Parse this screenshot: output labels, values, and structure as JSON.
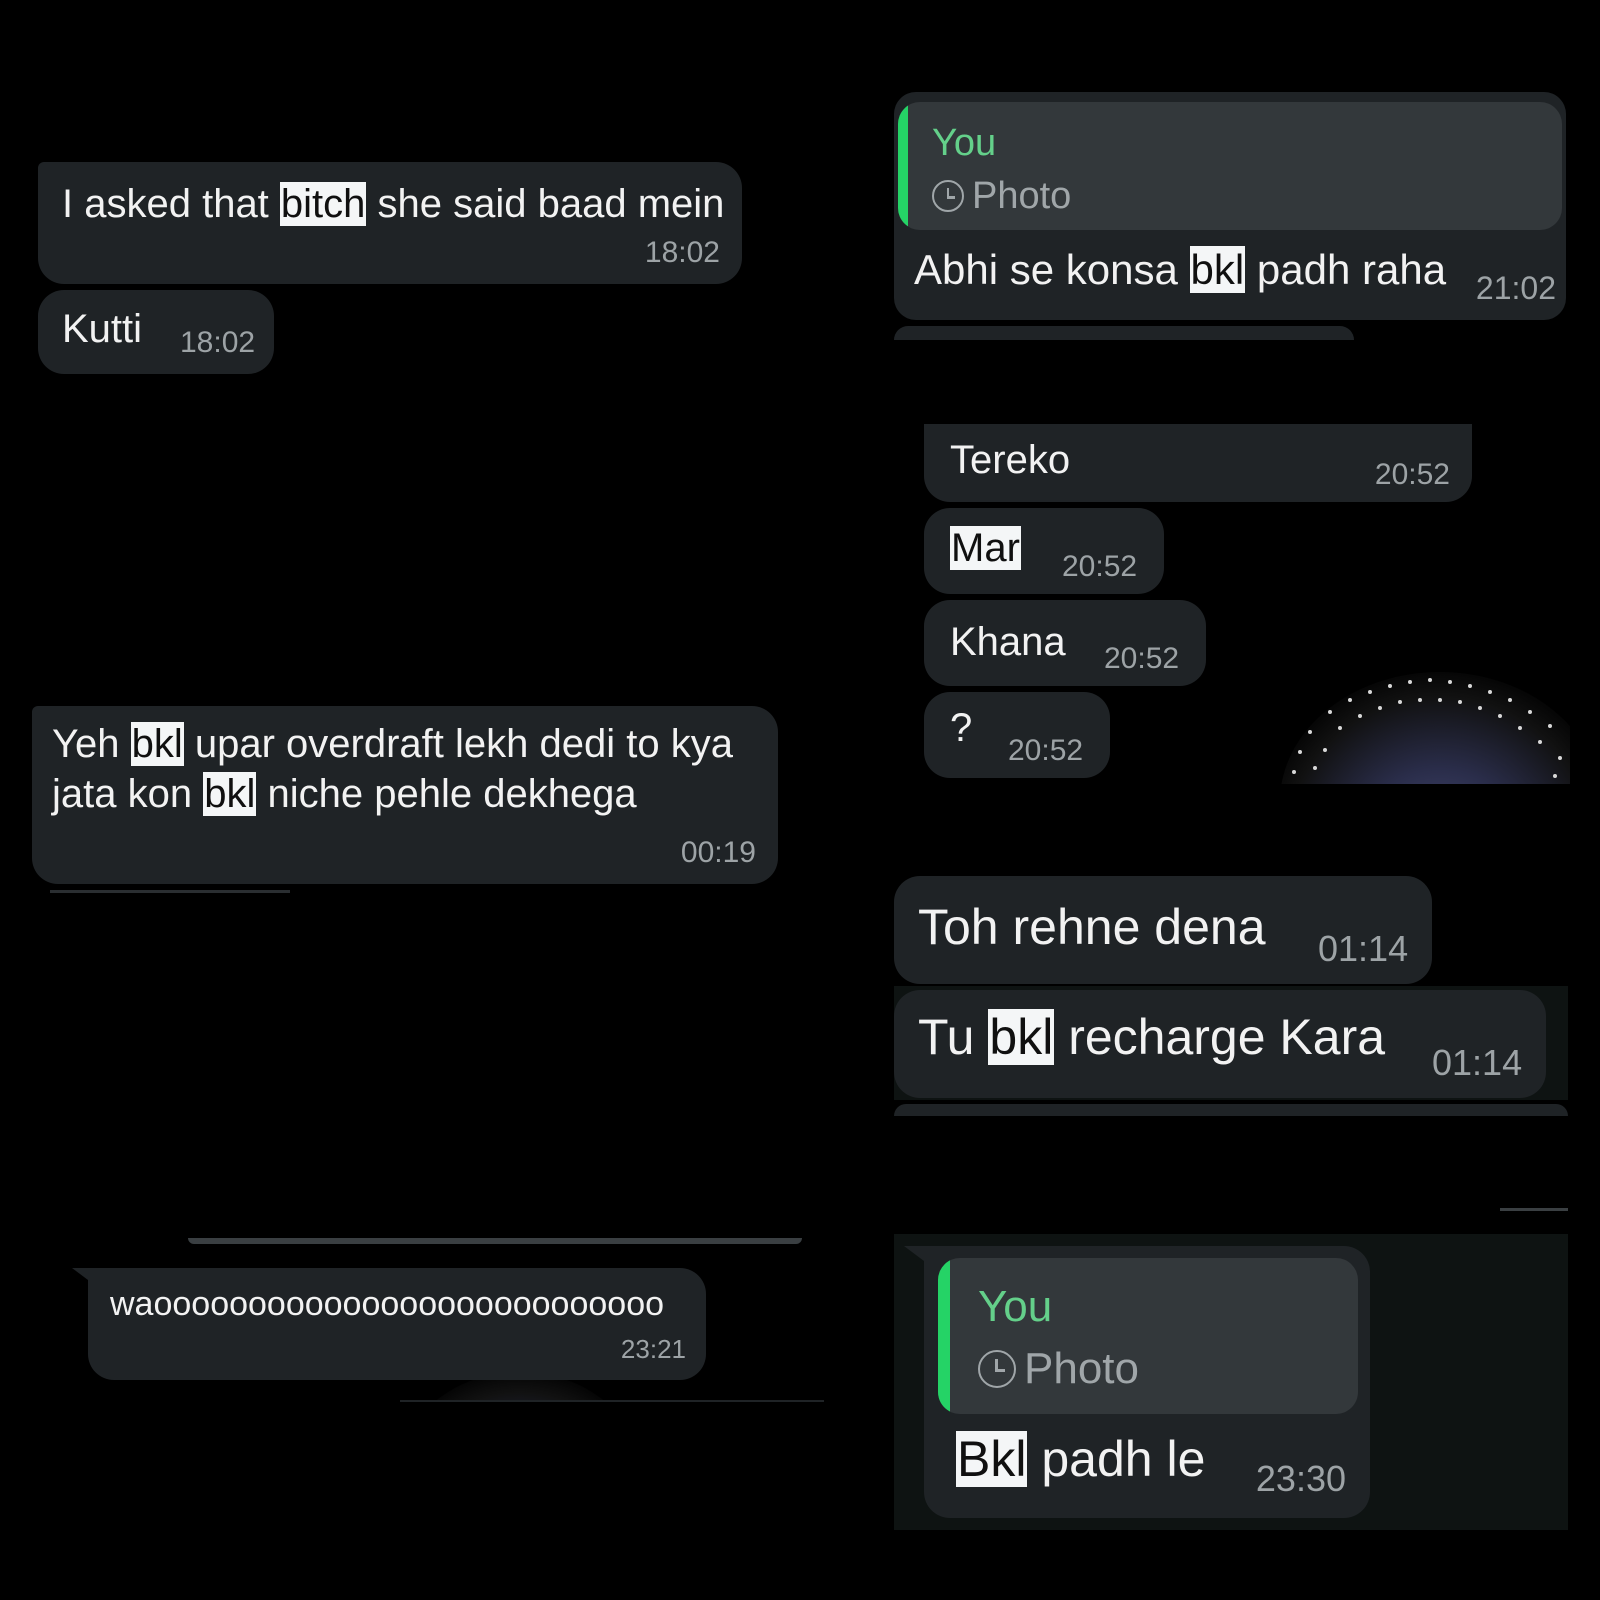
{
  "panels": {
    "p1": {
      "msg1": {
        "before": "I asked that ",
        "highlight": "bitch",
        "after": " she said baad mein",
        "time": "18:02"
      },
      "msg2": {
        "text": "Kutti",
        "time": "18:02"
      }
    },
    "p2": {
      "reply_you": "You",
      "reply_photo": "Photo",
      "before": "Abhi se konsa ",
      "highlight": "bkl",
      "after": " padh raha",
      "time": "21:02"
    },
    "p3": {
      "messages": [
        {
          "text": "Tereko",
          "time": "20:52"
        },
        {
          "text": "Mar",
          "time": "20:52"
        },
        {
          "text": "Khana",
          "time": "20:52"
        },
        {
          "text": "?",
          "time": "20:52"
        }
      ]
    },
    "p4": {
      "line1_before": "Yeh ",
      "line1_highlight": "bkl",
      "line1_after": " upar overdraft lekh dedi to kya",
      "line2_before": "jata kon ",
      "line2_highlight": "bkl",
      "line2_after": " niche pehle dekhega",
      "time": "00:19"
    },
    "p5": {
      "msg1": {
        "text": "Toh rehne dena",
        "time": "01:14"
      },
      "msg2": {
        "before": "Tu ",
        "highlight": "bkl",
        "after": " recharge Kara",
        "time": "01:14"
      }
    },
    "p6": {
      "text": "waooooooooooooooooooooooooooo",
      "time": "23:21"
    },
    "p7": {
      "reply_you": "You",
      "reply_photo": "Photo",
      "highlight": "Bkl",
      "after": " padh le",
      "time": "23:30"
    }
  }
}
